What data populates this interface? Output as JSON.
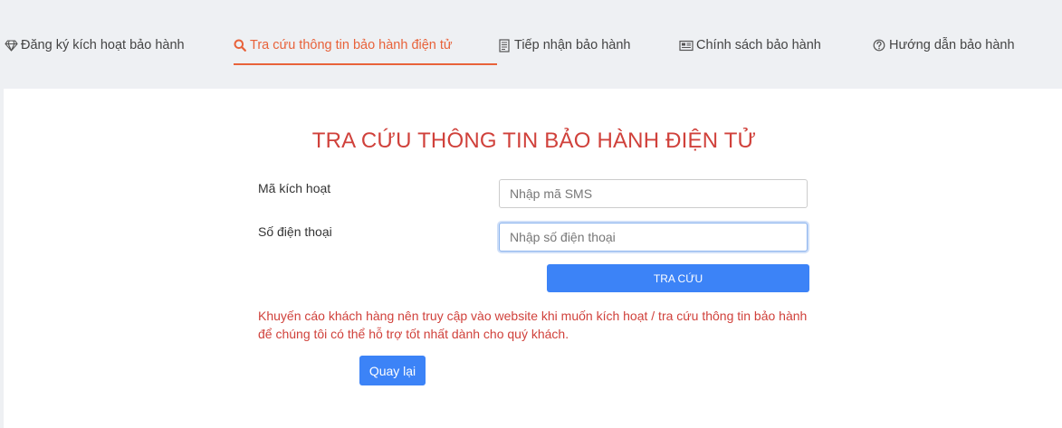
{
  "nav": {
    "tabs": [
      {
        "label": "Đăng ký kích hoạt bảo hành",
        "icon": "diamond-icon"
      },
      {
        "label": "Tra cứu thông tin bảo hành điện tử",
        "icon": "search-icon",
        "active": true
      },
      {
        "label": "Tiếp nhận bảo hành",
        "icon": "document-icon"
      },
      {
        "label": "Chính sách bảo hành",
        "icon": "newspaper-icon"
      },
      {
        "label": "Hướng dẫn bảo hành",
        "icon": "question-circle-icon"
      }
    ]
  },
  "form": {
    "title": "TRA CỨU THÔNG TIN BẢO HÀNH ĐIỆN TỬ",
    "activation_code_label": "Mã kích hoạt",
    "activation_code_placeholder": "Nhập mã SMS",
    "phone_label": "Số điện thoại",
    "phone_placeholder": "Nhập số điện thoại",
    "submit_label": "TRA CỨU",
    "notice_line1": "Khuyến cáo khách hàng nên truy cập vào website khi muốn kích hoạt / tra cứu thông tin bảo hành",
    "notice_line2": "để chúng tôi có thể hỗ trợ tốt nhất dành cho quý khách.",
    "back_label": "Quay lại"
  },
  "colors": {
    "accent": "#e8623a",
    "title": "#d0413b",
    "primary_button": "#3c83f7",
    "nav_background": "#eef0f3"
  }
}
